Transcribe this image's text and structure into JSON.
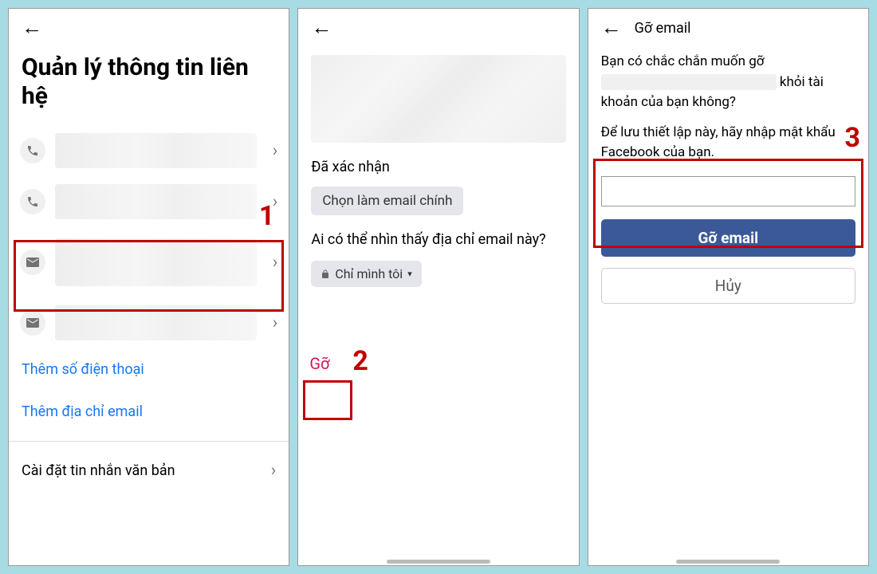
{
  "panel1": {
    "title": "Quản lý thông tin liên hệ",
    "add_phone": "Thêm số điện thoại",
    "add_email": "Thêm địa chỉ email",
    "sms_settings": "Cài đặt tin nhắn văn bản",
    "step_num": "1"
  },
  "panel2": {
    "confirmed_label": "Đã xác nhận",
    "set_primary_label": "Chọn làm email chính",
    "visibility_question": "Ai có thể nhìn thấy địa chỉ email này?",
    "privacy_value": "Chỉ mình tôi",
    "remove_label": "Gỡ",
    "step_num": "2"
  },
  "panel3": {
    "header_title": "Gỡ email",
    "confirm_text_1": "Bạn có chắc chắn muốn gỡ",
    "confirm_text_2": "khỏi tài khoản của bạn không?",
    "instruction": "Để lưu thiết lập này, hãy nhập mật khẩu Facebook của bạn.",
    "primary_btn": "Gỡ email",
    "cancel_btn": "Hủy",
    "step_num": "3"
  }
}
